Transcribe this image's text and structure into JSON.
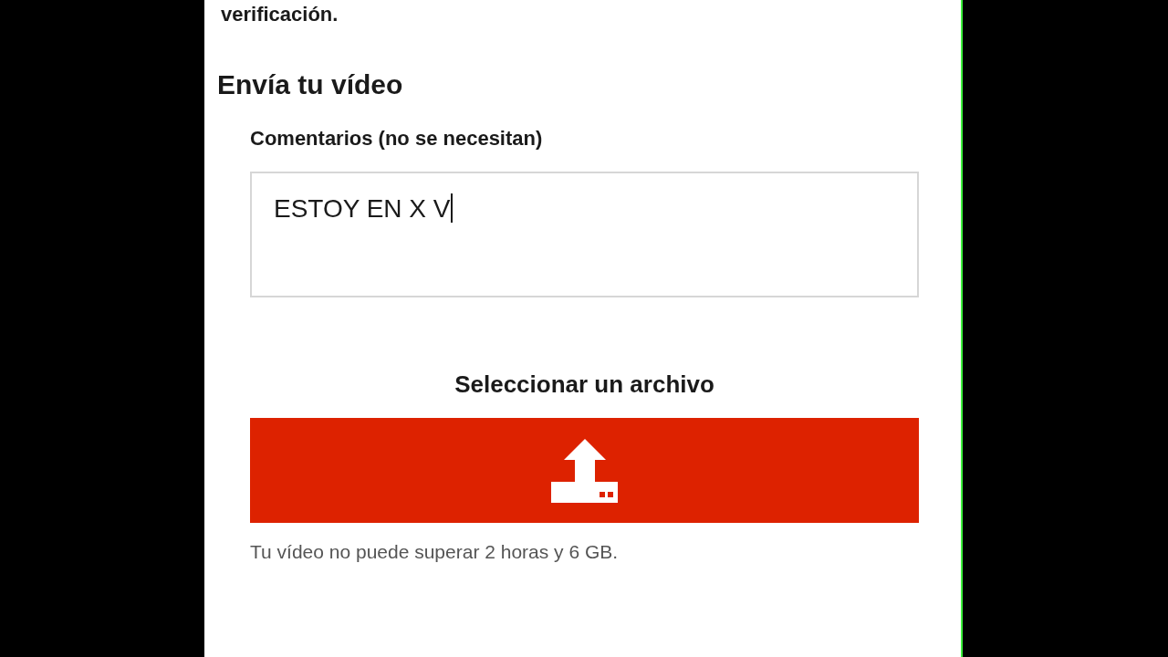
{
  "intro_text": "verificación.",
  "section": {
    "title": "Envía tu vídeo",
    "comments": {
      "label": "Comentarios (no se necesitan)",
      "value": "ESTOY EN X V",
      "focused": true
    },
    "file_picker": {
      "label": "Seleccionar un archivo"
    },
    "note": "Tu vídeo no puede superar 2 horas y 6 GB."
  }
}
